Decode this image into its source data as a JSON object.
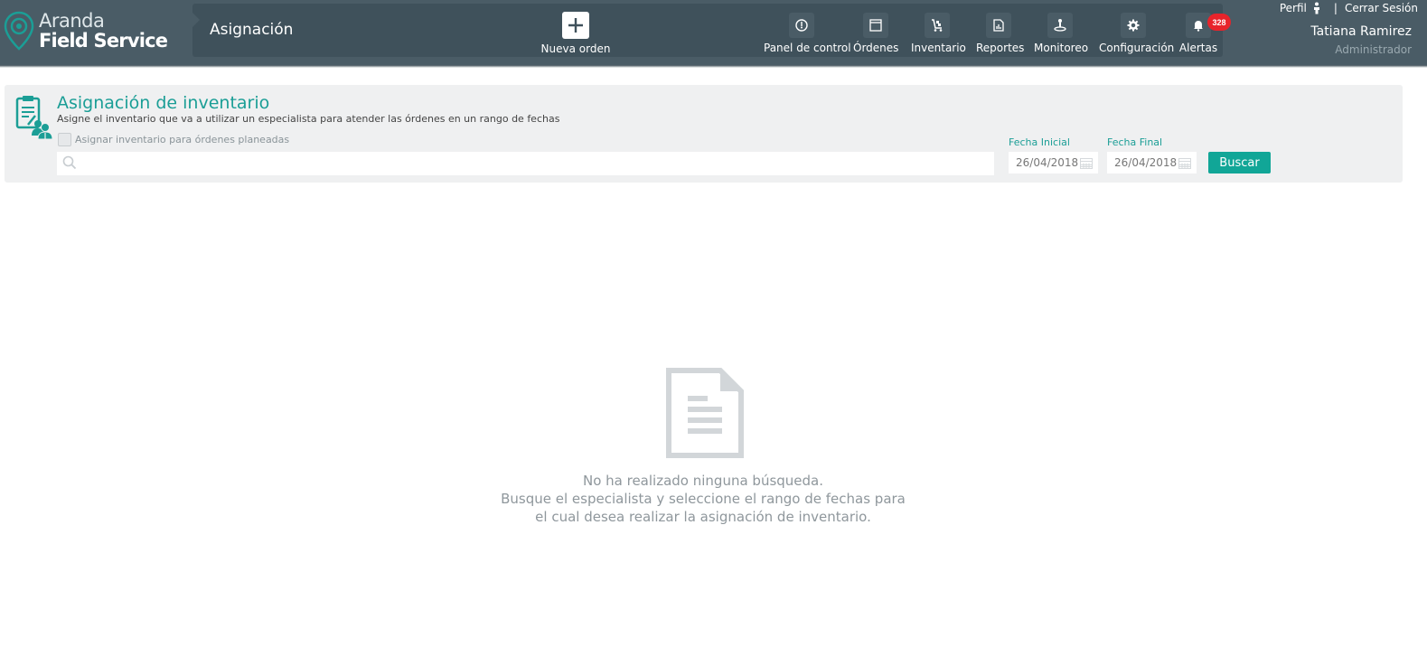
{
  "header": {
    "logo": {
      "line1": "Aranda",
      "line2": "Field Service"
    },
    "module_title": "Asignación",
    "new_order_label": "Nueva orden",
    "nav": [
      {
        "label": "Panel de control",
        "icon": "dashboard-icon"
      },
      {
        "label": "Órdenes",
        "icon": "orders-icon"
      },
      {
        "label": "Inventario",
        "icon": "inventory-icon"
      },
      {
        "label": "Reportes",
        "icon": "reports-icon"
      },
      {
        "label": "Monitoreo",
        "icon": "monitoring-icon"
      },
      {
        "label": "Configuración",
        "icon": "gear-icon"
      },
      {
        "label": "Alertas",
        "icon": "bell-icon"
      }
    ],
    "alerts_count": "328",
    "profile_link": "Perfil",
    "separator": "|",
    "logout_link": "Cerrar Sesión",
    "user_name": "Tatiana Ramirez",
    "user_role": "Administrador"
  },
  "panel": {
    "title": "Asignación de inventario",
    "subtitle": "Asigne el inventario que va a utilizar un especialista para atender las órdenes en un rango de fechas",
    "checkbox_label": "Asignar inventario para órdenes planeadas",
    "search_value": "",
    "start_date_label": "Fecha Inicial",
    "start_date": "26/04/2018",
    "end_date_label": "Fecha Final",
    "end_date": "26/04/2018",
    "search_button": "Buscar"
  },
  "empty_state": {
    "line1": "No ha realizado ninguna búsqueda.",
    "line2": "Busque el especialista y seleccione el rango de fechas para",
    "line3": "el cual desea realizar la asignación de inventario."
  },
  "colors": {
    "header_bg": "#4a5c66",
    "accent": "#1b9e96",
    "button": "#11a697",
    "badge": "#e8242b"
  }
}
